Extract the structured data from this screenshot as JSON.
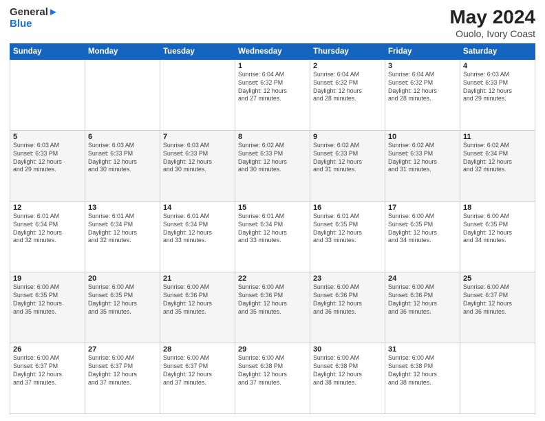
{
  "logo": {
    "line1": "General",
    "line2": "Blue"
  },
  "title": "May 2024",
  "subtitle": "Ouolo, Ivory Coast",
  "header": {
    "days": [
      "Sunday",
      "Monday",
      "Tuesday",
      "Wednesday",
      "Thursday",
      "Friday",
      "Saturday"
    ]
  },
  "weeks": [
    {
      "cells": [
        {
          "day": "",
          "info": ""
        },
        {
          "day": "",
          "info": ""
        },
        {
          "day": "",
          "info": ""
        },
        {
          "day": "1",
          "info": "Sunrise: 6:04 AM\nSunset: 6:32 PM\nDaylight: 12 hours\nand 27 minutes."
        },
        {
          "day": "2",
          "info": "Sunrise: 6:04 AM\nSunset: 6:32 PM\nDaylight: 12 hours\nand 28 minutes."
        },
        {
          "day": "3",
          "info": "Sunrise: 6:04 AM\nSunset: 6:32 PM\nDaylight: 12 hours\nand 28 minutes."
        },
        {
          "day": "4",
          "info": "Sunrise: 6:03 AM\nSunset: 6:33 PM\nDaylight: 12 hours\nand 29 minutes."
        }
      ]
    },
    {
      "cells": [
        {
          "day": "5",
          "info": "Sunrise: 6:03 AM\nSunset: 6:33 PM\nDaylight: 12 hours\nand 29 minutes."
        },
        {
          "day": "6",
          "info": "Sunrise: 6:03 AM\nSunset: 6:33 PM\nDaylight: 12 hours\nand 30 minutes."
        },
        {
          "day": "7",
          "info": "Sunrise: 6:03 AM\nSunset: 6:33 PM\nDaylight: 12 hours\nand 30 minutes."
        },
        {
          "day": "8",
          "info": "Sunrise: 6:02 AM\nSunset: 6:33 PM\nDaylight: 12 hours\nand 30 minutes."
        },
        {
          "day": "9",
          "info": "Sunrise: 6:02 AM\nSunset: 6:33 PM\nDaylight: 12 hours\nand 31 minutes."
        },
        {
          "day": "10",
          "info": "Sunrise: 6:02 AM\nSunset: 6:33 PM\nDaylight: 12 hours\nand 31 minutes."
        },
        {
          "day": "11",
          "info": "Sunrise: 6:02 AM\nSunset: 6:34 PM\nDaylight: 12 hours\nand 32 minutes."
        }
      ]
    },
    {
      "cells": [
        {
          "day": "12",
          "info": "Sunrise: 6:01 AM\nSunset: 6:34 PM\nDaylight: 12 hours\nand 32 minutes."
        },
        {
          "day": "13",
          "info": "Sunrise: 6:01 AM\nSunset: 6:34 PM\nDaylight: 12 hours\nand 32 minutes."
        },
        {
          "day": "14",
          "info": "Sunrise: 6:01 AM\nSunset: 6:34 PM\nDaylight: 12 hours\nand 33 minutes."
        },
        {
          "day": "15",
          "info": "Sunrise: 6:01 AM\nSunset: 6:34 PM\nDaylight: 12 hours\nand 33 minutes."
        },
        {
          "day": "16",
          "info": "Sunrise: 6:01 AM\nSunset: 6:35 PM\nDaylight: 12 hours\nand 33 minutes."
        },
        {
          "day": "17",
          "info": "Sunrise: 6:00 AM\nSunset: 6:35 PM\nDaylight: 12 hours\nand 34 minutes."
        },
        {
          "day": "18",
          "info": "Sunrise: 6:00 AM\nSunset: 6:35 PM\nDaylight: 12 hours\nand 34 minutes."
        }
      ]
    },
    {
      "cells": [
        {
          "day": "19",
          "info": "Sunrise: 6:00 AM\nSunset: 6:35 PM\nDaylight: 12 hours\nand 35 minutes."
        },
        {
          "day": "20",
          "info": "Sunrise: 6:00 AM\nSunset: 6:35 PM\nDaylight: 12 hours\nand 35 minutes."
        },
        {
          "day": "21",
          "info": "Sunrise: 6:00 AM\nSunset: 6:36 PM\nDaylight: 12 hours\nand 35 minutes."
        },
        {
          "day": "22",
          "info": "Sunrise: 6:00 AM\nSunset: 6:36 PM\nDaylight: 12 hours\nand 35 minutes."
        },
        {
          "day": "23",
          "info": "Sunrise: 6:00 AM\nSunset: 6:36 PM\nDaylight: 12 hours\nand 36 minutes."
        },
        {
          "day": "24",
          "info": "Sunrise: 6:00 AM\nSunset: 6:36 PM\nDaylight: 12 hours\nand 36 minutes."
        },
        {
          "day": "25",
          "info": "Sunrise: 6:00 AM\nSunset: 6:37 PM\nDaylight: 12 hours\nand 36 minutes."
        }
      ]
    },
    {
      "cells": [
        {
          "day": "26",
          "info": "Sunrise: 6:00 AM\nSunset: 6:37 PM\nDaylight: 12 hours\nand 37 minutes."
        },
        {
          "day": "27",
          "info": "Sunrise: 6:00 AM\nSunset: 6:37 PM\nDaylight: 12 hours\nand 37 minutes."
        },
        {
          "day": "28",
          "info": "Sunrise: 6:00 AM\nSunset: 6:37 PM\nDaylight: 12 hours\nand 37 minutes."
        },
        {
          "day": "29",
          "info": "Sunrise: 6:00 AM\nSunset: 6:38 PM\nDaylight: 12 hours\nand 37 minutes."
        },
        {
          "day": "30",
          "info": "Sunrise: 6:00 AM\nSunset: 6:38 PM\nDaylight: 12 hours\nand 38 minutes."
        },
        {
          "day": "31",
          "info": "Sunrise: 6:00 AM\nSunset: 6:38 PM\nDaylight: 12 hours\nand 38 minutes."
        },
        {
          "day": "",
          "info": ""
        }
      ]
    }
  ]
}
